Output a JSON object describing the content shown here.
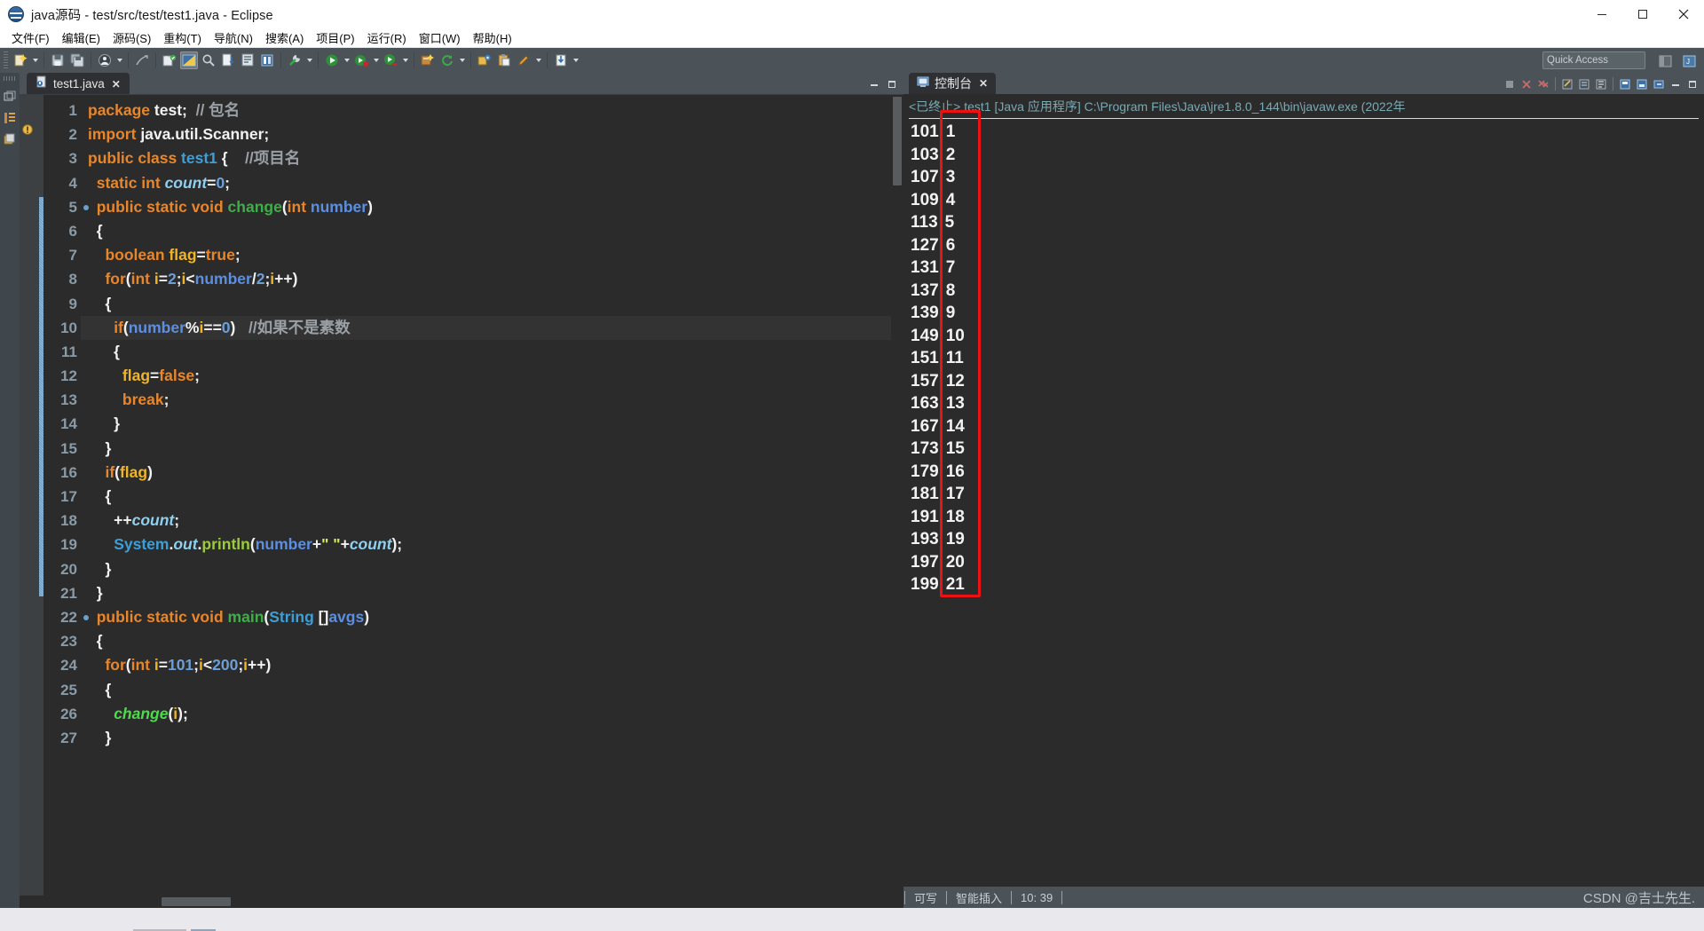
{
  "window": {
    "title": "java源码 - test/src/test/test1.java - Eclipse",
    "app_icon": "eclipse-icon",
    "minimize": "minimize-icon",
    "maximize": "maximize-icon",
    "close": "close-icon"
  },
  "menubar": [
    {
      "label": "文件(F)",
      "mnemonic": "F"
    },
    {
      "label": "编辑(E)",
      "mnemonic": "E"
    },
    {
      "label": "源码(S)",
      "mnemonic": "S"
    },
    {
      "label": "重构(T)",
      "mnemonic": "T"
    },
    {
      "label": "导航(N)",
      "mnemonic": "N"
    },
    {
      "label": "搜索(A)",
      "mnemonic": "A"
    },
    {
      "label": "项目(P)",
      "mnemonic": "P"
    },
    {
      "label": "运行(R)",
      "mnemonic": "R"
    },
    {
      "label": "窗口(W)",
      "mnemonic": "W"
    },
    {
      "label": "帮助(H)",
      "mnemonic": "H"
    }
  ],
  "toolbar": {
    "quick_access_placeholder": "Quick Access",
    "icons": [
      "new-wizard-icon",
      "save-icon",
      "save-all-icon",
      "print-icon",
      "toggle-mark-occurrences-icon",
      "new-java-project-icon",
      "open-perspective-icon",
      "search-icon",
      "next-annotation-icon",
      "previous-annotation-icon",
      "last-edit-location-icon",
      "external-tools-icon",
      "run-icon",
      "debug-icon",
      "coverage-icon",
      "new-class-icon",
      "refresh-icon",
      "open-type-icon",
      "paste-icon",
      "edit-icon",
      "download-icon"
    ]
  },
  "editor": {
    "tab": {
      "filename": "test1.java",
      "icon": "java-file-icon",
      "close": "close-icon"
    },
    "minimize": "minimize-icon",
    "maximize": "maximize-icon",
    "code_lines": [
      {
        "n": "1",
        "breakpoint": false,
        "highlight": false,
        "tokens": [
          {
            "t": "package ",
            "c": "k"
          },
          {
            "t": "test",
            "c": "w"
          },
          {
            "t": ";",
            "c": "w"
          },
          {
            "t": "  // 包名",
            "c": "cm"
          }
        ]
      },
      {
        "n": "2",
        "breakpoint": false,
        "highlight": false,
        "tokens": [
          {
            "t": "import ",
            "c": "k"
          },
          {
            "t": "java.util.Scanner;",
            "c": "w"
          }
        ]
      },
      {
        "n": "3",
        "breakpoint": false,
        "highlight": false,
        "tokens": [
          {
            "t": "public class ",
            "c": "k"
          },
          {
            "t": "test1",
            "c": "ty"
          },
          {
            "t": " {",
            "c": "w"
          },
          {
            "t": "    //项目名",
            "c": "cm"
          }
        ]
      },
      {
        "n": "4",
        "breakpoint": false,
        "highlight": false,
        "tokens": [
          {
            "t": "  ",
            "c": "w"
          },
          {
            "t": "static int ",
            "c": "k"
          },
          {
            "t": "count",
            "c": "fld"
          },
          {
            "t": "=",
            "c": "w"
          },
          {
            "t": "0",
            "c": "num"
          },
          {
            "t": ";",
            "c": "w"
          }
        ]
      },
      {
        "n": "5",
        "breakpoint": true,
        "highlight": false,
        "tokens": [
          {
            "t": "  ",
            "c": "w"
          },
          {
            "t": "public static void ",
            "c": "k"
          },
          {
            "t": "change",
            "c": "mth"
          },
          {
            "t": "(",
            "c": "w"
          },
          {
            "t": "int ",
            "c": "k"
          },
          {
            "t": "number",
            "c": "prm"
          },
          {
            "t": ")",
            "c": "w"
          }
        ]
      },
      {
        "n": "6",
        "breakpoint": false,
        "highlight": false,
        "tokens": [
          {
            "t": "  {",
            "c": "w"
          }
        ]
      },
      {
        "n": "7",
        "breakpoint": false,
        "highlight": false,
        "tokens": [
          {
            "t": "    ",
            "c": "w"
          },
          {
            "t": "boolean ",
            "c": "k"
          },
          {
            "t": "flag",
            "c": "loc"
          },
          {
            "t": "=",
            "c": "w"
          },
          {
            "t": "true",
            "c": "k"
          },
          {
            "t": ";",
            "c": "w"
          }
        ]
      },
      {
        "n": "8",
        "breakpoint": false,
        "highlight": false,
        "tokens": [
          {
            "t": "    ",
            "c": "w"
          },
          {
            "t": "for",
            "c": "k"
          },
          {
            "t": "(",
            "c": "w"
          },
          {
            "t": "int ",
            "c": "k"
          },
          {
            "t": "i",
            "c": "loc"
          },
          {
            "t": "=",
            "c": "w"
          },
          {
            "t": "2",
            "c": "num"
          },
          {
            "t": ";",
            "c": "w"
          },
          {
            "t": "i",
            "c": "loc"
          },
          {
            "t": "<",
            "c": "w"
          },
          {
            "t": "number",
            "c": "prm"
          },
          {
            "t": "/",
            "c": "w"
          },
          {
            "t": "2",
            "c": "num"
          },
          {
            "t": ";",
            "c": "w"
          },
          {
            "t": "i",
            "c": "loc"
          },
          {
            "t": "++)",
            "c": "w"
          }
        ]
      },
      {
        "n": "9",
        "breakpoint": false,
        "highlight": false,
        "tokens": [
          {
            "t": "    {",
            "c": "w"
          }
        ]
      },
      {
        "n": "10",
        "breakpoint": false,
        "highlight": true,
        "tokens": [
          {
            "t": "      ",
            "c": "w"
          },
          {
            "t": "if",
            "c": "k"
          },
          {
            "t": "(",
            "c": "w"
          },
          {
            "t": "number",
            "c": "prm"
          },
          {
            "t": "%",
            "c": "w"
          },
          {
            "t": "i",
            "c": "loc"
          },
          {
            "t": "==",
            "c": "w"
          },
          {
            "t": "0",
            "c": "num"
          },
          {
            "t": ")",
            "c": "w"
          },
          {
            "t": "   //如果不是素数",
            "c": "cm"
          }
        ]
      },
      {
        "n": "11",
        "breakpoint": false,
        "highlight": false,
        "tokens": [
          {
            "t": "      {",
            "c": "w"
          }
        ]
      },
      {
        "n": "12",
        "breakpoint": false,
        "highlight": false,
        "tokens": [
          {
            "t": "        ",
            "c": "w"
          },
          {
            "t": "flag",
            "c": "loc"
          },
          {
            "t": "=",
            "c": "w"
          },
          {
            "t": "false",
            "c": "k"
          },
          {
            "t": ";",
            "c": "w"
          }
        ]
      },
      {
        "n": "13",
        "breakpoint": false,
        "highlight": false,
        "tokens": [
          {
            "t": "        ",
            "c": "w"
          },
          {
            "t": "break",
            "c": "k"
          },
          {
            "t": ";",
            "c": "w"
          }
        ]
      },
      {
        "n": "14",
        "breakpoint": false,
        "highlight": false,
        "tokens": [
          {
            "t": "      }",
            "c": "w"
          }
        ]
      },
      {
        "n": "15",
        "breakpoint": false,
        "highlight": false,
        "tokens": [
          {
            "t": "    }",
            "c": "w"
          }
        ]
      },
      {
        "n": "16",
        "breakpoint": false,
        "highlight": false,
        "tokens": [
          {
            "t": "    ",
            "c": "w"
          },
          {
            "t": "if",
            "c": "k"
          },
          {
            "t": "(",
            "c": "w"
          },
          {
            "t": "flag",
            "c": "loc"
          },
          {
            "t": ")",
            "c": "w"
          }
        ]
      },
      {
        "n": "17",
        "breakpoint": false,
        "highlight": false,
        "tokens": [
          {
            "t": "    {",
            "c": "w"
          }
        ]
      },
      {
        "n": "18",
        "breakpoint": false,
        "highlight": false,
        "tokens": [
          {
            "t": "      ++",
            "c": "w"
          },
          {
            "t": "count",
            "c": "fld"
          },
          {
            "t": ";",
            "c": "w"
          }
        ]
      },
      {
        "n": "19",
        "breakpoint": false,
        "highlight": false,
        "tokens": [
          {
            "t": "      ",
            "c": "w"
          },
          {
            "t": "System",
            "c": "ty"
          },
          {
            "t": ".",
            "c": "w"
          },
          {
            "t": "out",
            "c": "fld"
          },
          {
            "t": ".",
            "c": "w"
          },
          {
            "t": "println",
            "c": "call"
          },
          {
            "t": "(",
            "c": "w"
          },
          {
            "t": "number",
            "c": "prm"
          },
          {
            "t": "+",
            "c": "w"
          },
          {
            "t": "\" \"",
            "c": "str"
          },
          {
            "t": "+",
            "c": "w"
          },
          {
            "t": "count",
            "c": "fld"
          },
          {
            "t": ");",
            "c": "w"
          }
        ]
      },
      {
        "n": "20",
        "breakpoint": false,
        "highlight": false,
        "tokens": [
          {
            "t": "    }",
            "c": "w"
          }
        ]
      },
      {
        "n": "21",
        "breakpoint": false,
        "highlight": false,
        "tokens": [
          {
            "t": "  }",
            "c": "w"
          }
        ]
      },
      {
        "n": "22",
        "breakpoint": true,
        "highlight": false,
        "tokens": [
          {
            "t": "  ",
            "c": "w"
          },
          {
            "t": "public static void ",
            "c": "k"
          },
          {
            "t": "main",
            "c": "mth"
          },
          {
            "t": "(",
            "c": "w"
          },
          {
            "t": "String",
            "c": "ty"
          },
          {
            "t": " []",
            "c": "w"
          },
          {
            "t": "avgs",
            "c": "prm"
          },
          {
            "t": ")",
            "c": "w"
          }
        ]
      },
      {
        "n": "23",
        "breakpoint": false,
        "highlight": false,
        "tokens": [
          {
            "t": "  {",
            "c": "w"
          }
        ]
      },
      {
        "n": "24",
        "breakpoint": false,
        "highlight": false,
        "tokens": [
          {
            "t": "    ",
            "c": "w"
          },
          {
            "t": "for",
            "c": "k"
          },
          {
            "t": "(",
            "c": "w"
          },
          {
            "t": "int ",
            "c": "k"
          },
          {
            "t": "i",
            "c": "loc"
          },
          {
            "t": "=",
            "c": "w"
          },
          {
            "t": "101",
            "c": "num"
          },
          {
            "t": ";",
            "c": "w"
          },
          {
            "t": "i",
            "c": "loc"
          },
          {
            "t": "<",
            "c": "w"
          },
          {
            "t": "200",
            "c": "num"
          },
          {
            "t": ";",
            "c": "w"
          },
          {
            "t": "i",
            "c": "loc"
          },
          {
            "t": "++)",
            "c": "w"
          }
        ]
      },
      {
        "n": "25",
        "breakpoint": false,
        "highlight": false,
        "tokens": [
          {
            "t": "    {",
            "c": "w"
          }
        ]
      },
      {
        "n": "26",
        "breakpoint": false,
        "highlight": false,
        "tokens": [
          {
            "t": "      ",
            "c": "w"
          },
          {
            "t": "change",
            "c": "mthi"
          },
          {
            "t": "(",
            "c": "w"
          },
          {
            "t": "i",
            "c": "loc"
          },
          {
            "t": ");",
            "c": "w"
          }
        ]
      },
      {
        "n": "27",
        "breakpoint": false,
        "highlight": false,
        "tokens": [
          {
            "t": "    }",
            "c": "w"
          }
        ]
      }
    ]
  },
  "console": {
    "tab_label": "控制台",
    "tab_icon": "console-icon",
    "tab_close": "close-icon",
    "header": "<已终止> test1 [Java 应用程序] C:\\Program Files\\Java\\jre1.8.0_144\\bin\\javaw.exe  (2022年",
    "toolbar_icons": [
      "terminate-icon",
      "remove-launch-icon",
      "remove-all-terminated-icon",
      "clear-console-icon",
      "scroll-lock-icon",
      "word-wrap-icon",
      "pin-console-icon",
      "display-selected-console-icon",
      "open-console-icon",
      "minimize-icon",
      "maximize-icon"
    ],
    "output": [
      {
        "value": "101",
        "index": "1"
      },
      {
        "value": "103",
        "index": "2"
      },
      {
        "value": "107",
        "index": "3"
      },
      {
        "value": "109",
        "index": "4"
      },
      {
        "value": "113",
        "index": "5"
      },
      {
        "value": "127",
        "index": "6"
      },
      {
        "value": "131",
        "index": "7"
      },
      {
        "value": "137",
        "index": "8"
      },
      {
        "value": "139",
        "index": "9"
      },
      {
        "value": "149",
        "index": "10"
      },
      {
        "value": "151",
        "index": "11"
      },
      {
        "value": "157",
        "index": "12"
      },
      {
        "value": "163",
        "index": "13"
      },
      {
        "value": "167",
        "index": "14"
      },
      {
        "value": "173",
        "index": "15"
      },
      {
        "value": "179",
        "index": "16"
      },
      {
        "value": "181",
        "index": "17"
      },
      {
        "value": "191",
        "index": "18"
      },
      {
        "value": "193",
        "index": "19"
      },
      {
        "value": "197",
        "index": "20"
      },
      {
        "value": "199",
        "index": "21"
      }
    ],
    "annotation_color": "#ee1111"
  },
  "statusbar": {
    "writable": "可写",
    "insert_mode": "智能插入",
    "cursor_position": "10: 39",
    "watermark": "CSDN @吉士先生."
  }
}
